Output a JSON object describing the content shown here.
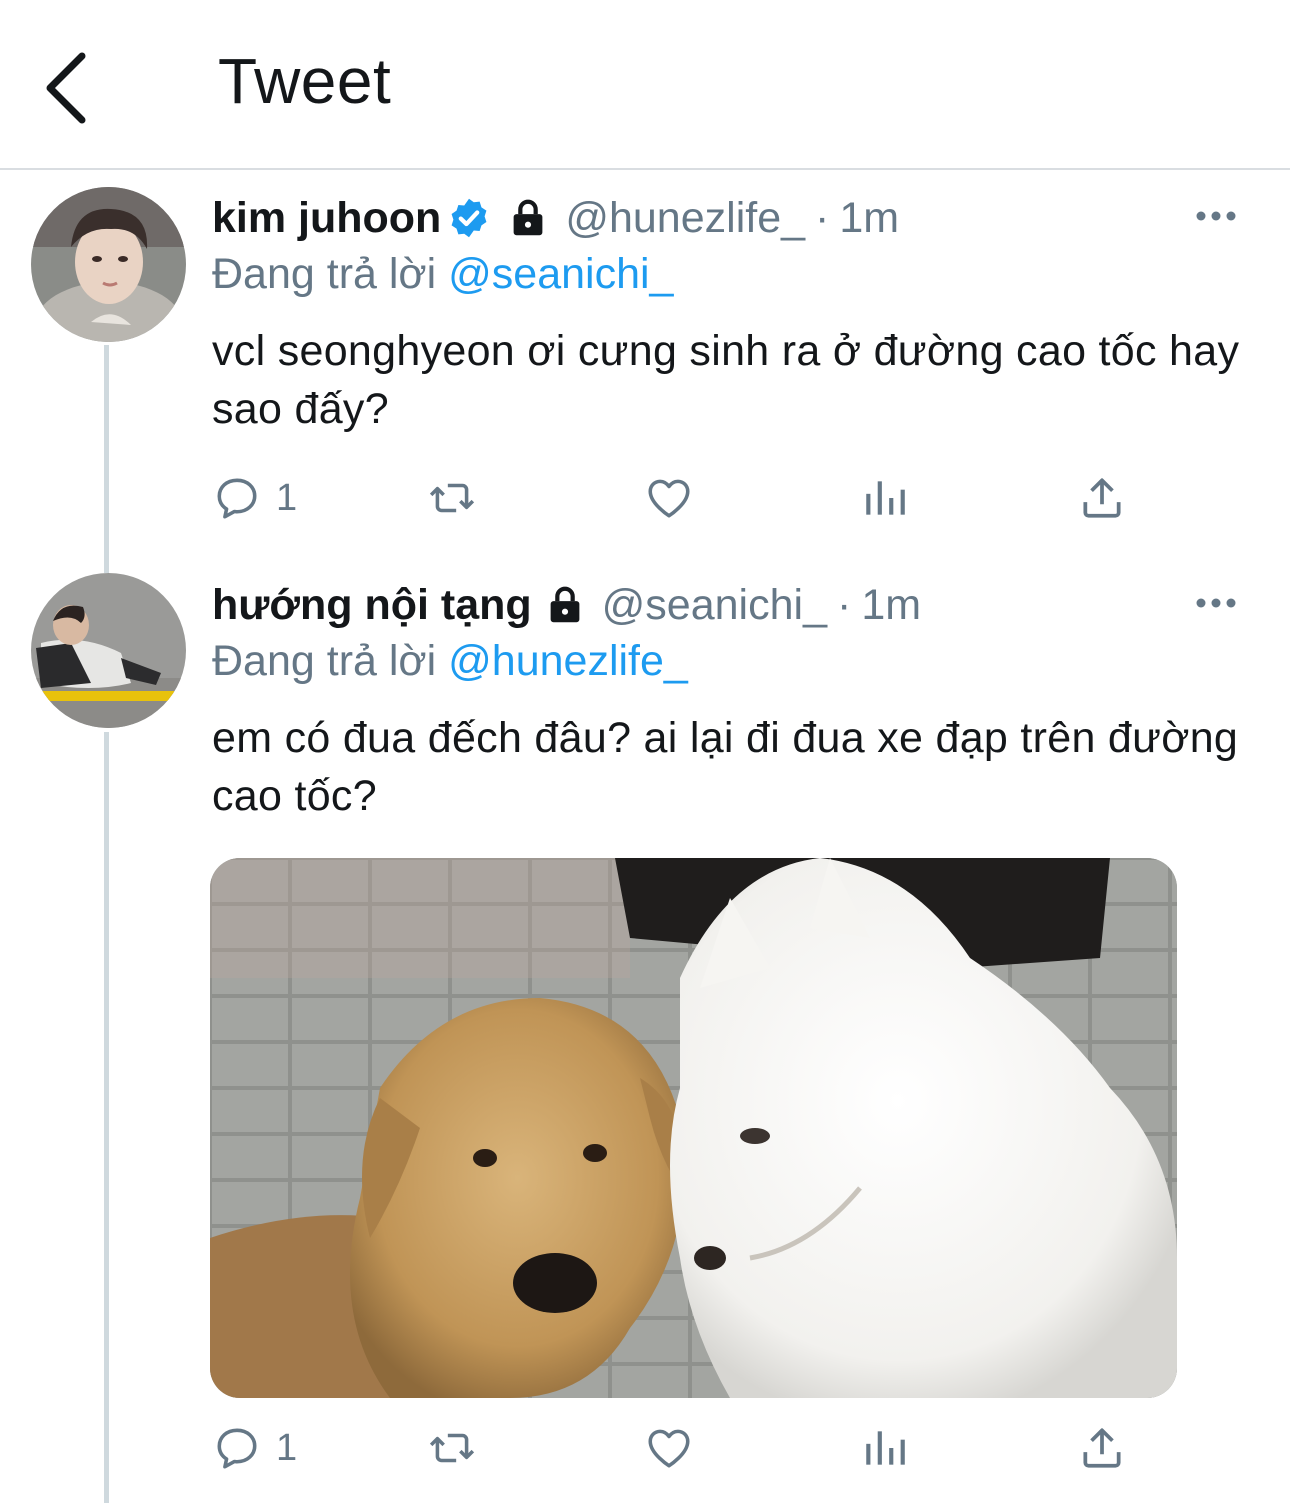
{
  "header": {
    "title": "Tweet"
  },
  "tweets": [
    {
      "display_name": "kim juhoon",
      "verified": true,
      "protected": true,
      "handle": "@hunezlife_",
      "separator": "·",
      "time": "1m",
      "replying_prefix": "Đang trả lời",
      "replying_to": "@seanichi_",
      "text": "vcl seonghyeon ơi cưng sinh ra ở đường cao tốc hay sao đấy?",
      "reply_count": "1",
      "avatar_icon": "user-avatar"
    },
    {
      "display_name": "hướng nội tạng",
      "verified": false,
      "protected": true,
      "handle": "@seanichi_",
      "separator": "·",
      "time": "1m",
      "replying_prefix": "Đang trả lời",
      "replying_to": "@hunezlife_",
      "text": "em có đua đếch đâu? ai lại đi đua xe đạp trên đường cao tốc?",
      "reply_count": "1",
      "avatar_icon": "user-avatar",
      "media": {
        "kind": "photo",
        "subject": "golden-retriever-and-samoyed"
      }
    }
  ],
  "colors": {
    "link": "#1d9bf0",
    "muted": "#657786",
    "text": "#14171a",
    "divider": "#d9dde1",
    "verified": "#1d9bf0"
  }
}
